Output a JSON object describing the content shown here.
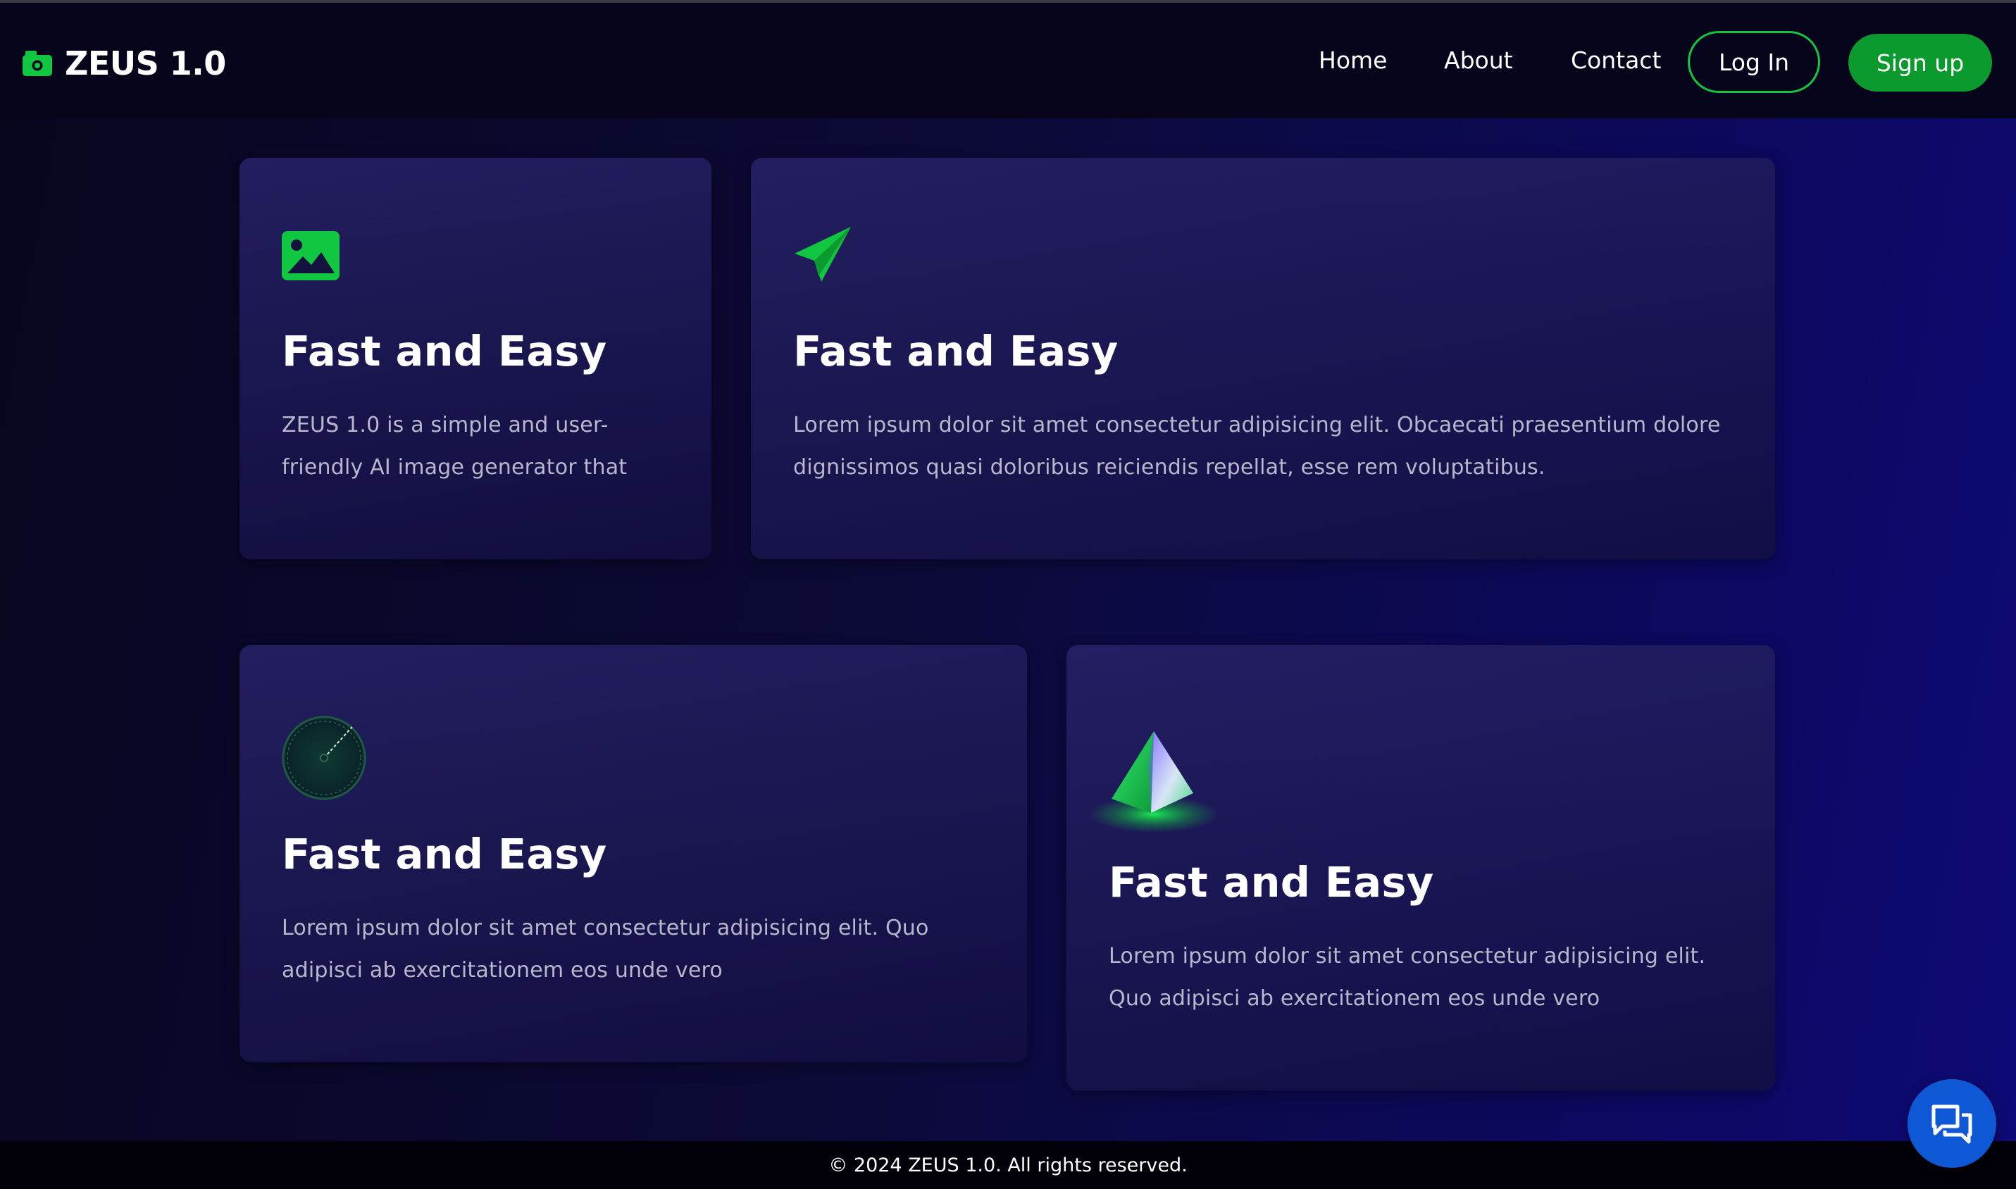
{
  "brand": {
    "name": "ZEUS 1.0",
    "icon": "camera-icon",
    "accent": "#11c640"
  },
  "nav": {
    "links": [
      "Home",
      "About",
      "Contact"
    ],
    "login_label": "Log In",
    "signup_label": "Sign up"
  },
  "cards": [
    {
      "icon": "image-icon",
      "title": "Fast and Easy",
      "text": "ZEUS 1.0 is a simple and user-friendly AI image generator that"
    },
    {
      "icon": "paper-plane-icon",
      "title": "Fast and Easy",
      "text": "Lorem ipsum dolor sit amet consectetur adipisicing elit. Obcaecati praesentium dolore dignissimos quasi doloribus reiciendis repellat, esse rem voluptatibus."
    },
    {
      "icon": "radar-icon",
      "title": "Fast and Easy",
      "text": "Lorem ipsum dolor sit amet consectetur adipisicing elit. Quo adipisci ab exercitationem eos unde vero"
    },
    {
      "icon": "pyramid-icon",
      "title": "Fast and Easy",
      "text": "Lorem ipsum dolor sit amet consectetur adipisicing elit. Quo adipisci ab exercitationem eos unde vero"
    }
  ],
  "footer": {
    "text": "© 2024 ZEUS 1.0. All rights reserved."
  },
  "chat": {
    "icon": "chat-icon",
    "color": "#0e58d6"
  }
}
